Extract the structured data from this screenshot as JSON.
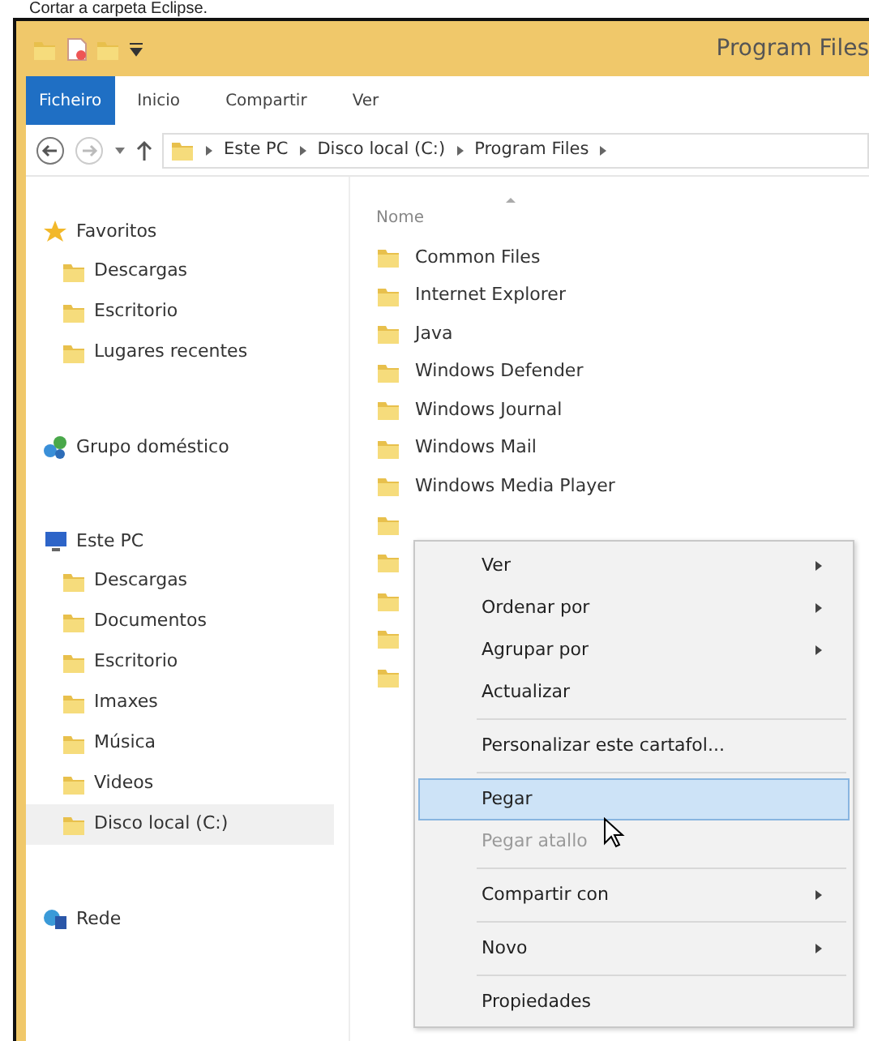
{
  "caption": "Cortar a carpeta Eclipse.",
  "window": {
    "title": "Program Files"
  },
  "tabs": [
    {
      "label": "Ficheiro",
      "kind": "file"
    },
    {
      "label": "Inicio",
      "kind": "tab"
    },
    {
      "label": "Compartir",
      "kind": "tab"
    },
    {
      "label": "Ver",
      "kind": "tab"
    }
  ],
  "address": {
    "crumbs": [
      "Este PC",
      "Disco local (C:)",
      "Program Files"
    ]
  },
  "sidebar": {
    "groups": [
      {
        "label": "Favoritos",
        "children": [
          {
            "label": "Descargas",
            "selected": false
          },
          {
            "label": "Escritorio",
            "selected": false
          },
          {
            "label": "Lugares recentes",
            "selected": false
          }
        ]
      },
      {
        "label": "Grupo doméstico"
      },
      {
        "label": "Este PC",
        "children": [
          {
            "label": "Descargas",
            "selected": false
          },
          {
            "label": "Documentos",
            "selected": false
          },
          {
            "label": "Escritorio",
            "selected": false
          },
          {
            "label": "Imaxes",
            "selected": false
          },
          {
            "label": "Música",
            "selected": false
          },
          {
            "label": "Videos",
            "selected": false
          },
          {
            "label": "Disco local (C:)",
            "selected": true
          }
        ]
      },
      {
        "label": "Rede"
      }
    ]
  },
  "content": {
    "column": "Nome",
    "folders": [
      {
        "kind": "named",
        "name": "Common Files"
      },
      {
        "kind": "named",
        "name": "Internet Explorer"
      },
      {
        "kind": "named",
        "name": "Java"
      },
      {
        "kind": "named",
        "name": "Windows Defender"
      },
      {
        "kind": "named",
        "name": "Windows Journal"
      },
      {
        "kind": "named",
        "name": "Windows Mail"
      },
      {
        "kind": "named",
        "name": "Windows Media Player"
      },
      {
        "kind": "covered"
      },
      {
        "kind": "covered"
      },
      {
        "kind": "covered"
      },
      {
        "kind": "covered"
      },
      {
        "kind": "covered"
      }
    ]
  },
  "context_menu": [
    {
      "kind": "item",
      "label": "Ver",
      "submenu": true,
      "selected": false,
      "disabled": false
    },
    {
      "kind": "item",
      "label": "Ordenar por",
      "submenu": true,
      "selected": false,
      "disabled": false
    },
    {
      "kind": "item",
      "label": "Agrupar por",
      "submenu": true,
      "selected": false,
      "disabled": false
    },
    {
      "kind": "item",
      "label": "Actualizar",
      "submenu": false,
      "selected": false,
      "disabled": false
    },
    {
      "kind": "separator"
    },
    {
      "kind": "item",
      "label": "Personalizar este cartafol...",
      "submenu": false,
      "selected": false,
      "disabled": false
    },
    {
      "kind": "separator"
    },
    {
      "kind": "item",
      "label": "Pegar",
      "submenu": false,
      "selected": true,
      "disabled": false
    },
    {
      "kind": "item",
      "label": "Pegar atallo",
      "submenu": false,
      "selected": false,
      "disabled": true
    },
    {
      "kind": "separator"
    },
    {
      "kind": "item",
      "label": "Compartir con",
      "submenu": true,
      "selected": false,
      "disabled": false
    },
    {
      "kind": "separator"
    },
    {
      "kind": "item",
      "label": "Novo",
      "submenu": true,
      "selected": false,
      "disabled": false
    },
    {
      "kind": "separator"
    },
    {
      "kind": "item",
      "label": "Propiedades",
      "submenu": false,
      "selected": false,
      "disabled": false
    }
  ]
}
